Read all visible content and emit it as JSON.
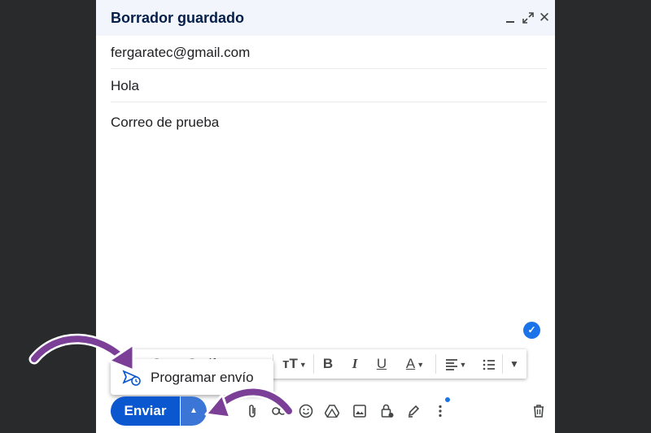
{
  "compose": {
    "title": "Borrador guardado",
    "to": "fergaratec@gmail.com",
    "subject": "Hola",
    "body": "Correo de prueba"
  },
  "header_icons": [
    "minimize-icon",
    "expand-icon",
    "close-icon"
  ],
  "format_toolbar": {
    "font_partial": "←  Sans Serif",
    "size_label": "тТ",
    "bold": "B",
    "italic": "I",
    "underline": "U",
    "color": "A"
  },
  "schedule_menu": {
    "label": "Programar envío"
  },
  "send": {
    "label": "Enviar"
  },
  "colors": {
    "accent": "#0b57d0",
    "annotation_arrow": "#7b3f98",
    "header_bg": "#f2f6fc"
  }
}
